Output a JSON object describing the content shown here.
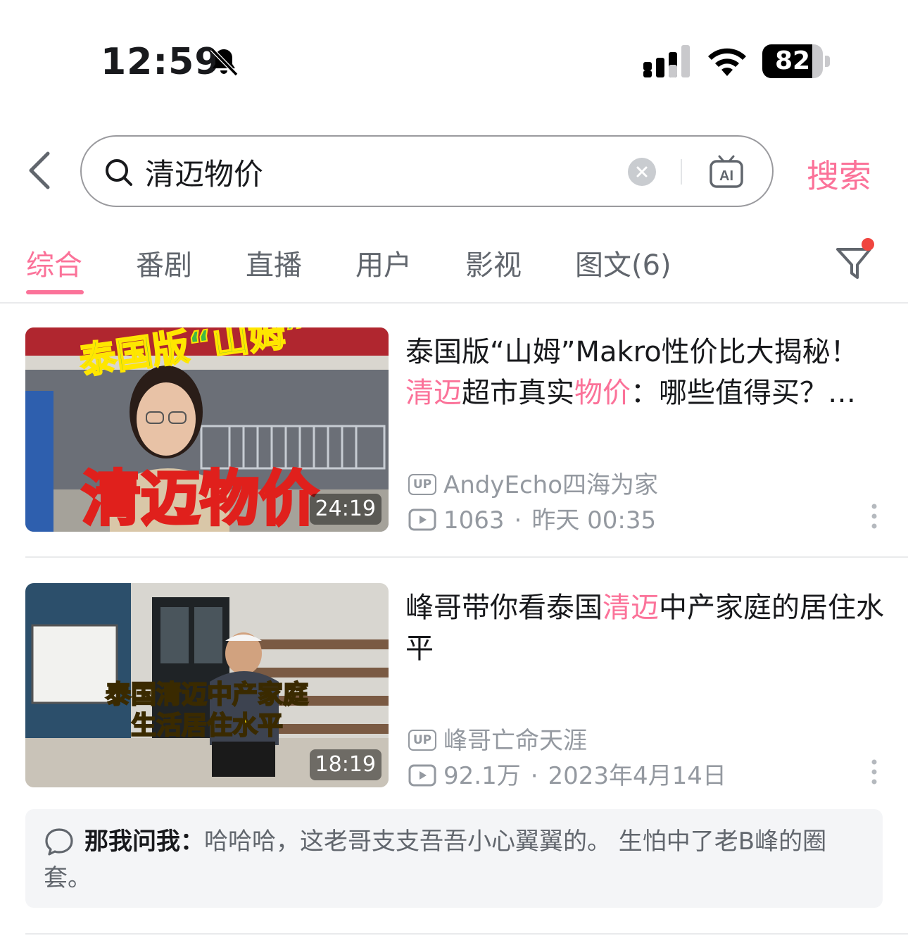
{
  "status_bar": {
    "time": "12:59",
    "battery_level": "82",
    "battery_fraction": 0.82
  },
  "search": {
    "query": "清迈物价",
    "ai_label": "AI",
    "submit_label": "搜索"
  },
  "tabs": [
    {
      "label": "综合",
      "active": true
    },
    {
      "label": "番剧",
      "active": false
    },
    {
      "label": "直播",
      "active": false
    },
    {
      "label": "用户",
      "active": false
    },
    {
      "label": "影视",
      "active": false
    },
    {
      "label": "图文(6)",
      "active": false
    }
  ],
  "results": [
    {
      "title_parts": [
        {
          "text": "泰国版“山姆”Makro性价比大揭秘！",
          "hl": false
        },
        {
          "text": "清迈",
          "hl": true
        },
        {
          "text": "超市真实",
          "hl": false
        },
        {
          "text": "物价",
          "hl": true
        },
        {
          "text": "：哪些值得买？…",
          "hl": false
        }
      ],
      "thumb_caption_top": "泰国版“山姆”",
      "thumb_caption_bottom": "清迈物价",
      "duration": "24:19",
      "up_badge": "UP",
      "author": "AndyEcho四海为家",
      "views": "1063",
      "date": "昨天 00:35"
    },
    {
      "title_parts": [
        {
          "text": "峰哥带你看泰国",
          "hl": false
        },
        {
          "text": "清迈",
          "hl": true
        },
        {
          "text": "中产家庭的居住水平",
          "hl": false
        }
      ],
      "thumb_caption_line1": "泰国清迈中产家庭",
      "thumb_caption_line2": "生活居住水平",
      "duration": "18:19",
      "up_badge": "UP",
      "author": "峰哥亡命天涯",
      "views": "92.1万",
      "date": "2023年4月14日"
    }
  ],
  "meta_separator": "·",
  "comment": {
    "user": "那我问我：",
    "text": "哈哈哈，这老哥支支吾吾小心翼翼的。 生怕中了老B峰的圈套。"
  },
  "colors": {
    "accent": "#fb7299",
    "text_primary": "#18191c",
    "text_secondary": "#9499a0"
  }
}
